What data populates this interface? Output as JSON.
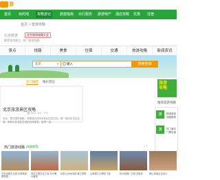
{
  "header": {
    "logo_text": "游"
  },
  "nav": [
    {
      "label": "首页",
      "active": false
    },
    {
      "label": "目的地",
      "active": false
    },
    {
      "label": "攻略游记",
      "active": true
    },
    {
      "label": "旅游指南",
      "active": false
    },
    {
      "label": "出行服务",
      "active": false
    },
    {
      "label": "旅游特产",
      "active": false
    },
    {
      "label": "酒店攻略",
      "active": false
    },
    {
      "label": "优惠",
      "active": false
    },
    {
      "label": "住宿",
      "active": false
    }
  ],
  "breadcrumb": "首页 > 旅游攻略",
  "subhead": {
    "location": "北京旅游",
    "badge": "北京旅游攻略大全",
    "line": "推荐旅游景点 · 热门旅游线路"
  },
  "categories": [
    "景点",
    "线路",
    "美食",
    "住宿",
    "交通",
    "旅游攻略",
    "新闻资讯"
  ],
  "search": {
    "city": "北京",
    "city_arrow": "▼",
    "query": "输入",
    "button": "搜索查询"
  },
  "promo": {
    "line1": "旅游",
    "line2": "攻略"
  },
  "hot_tabs": [
    "热门推荐",
    "精彩游记"
  ],
  "article": {
    "title": "北京旅游景区攻略",
    "meta": "👁 2021  ·  ♥ 4  ·  ✎ 5",
    "desc": "北京，是中国的首都，有着悠久的历史和灿烂的文化，是一座历史文化名城，拥有众多名胜古迹和自然景观，值得一游。"
  },
  "sidebar": {
    "title": "推荐旅游线路",
    "ads": [
      {
        "badge": "游",
        "text": "精选旅游线路推荐"
      },
      {
        "badge": "游",
        "text": "热门景点门票优惠"
      }
    ]
  },
  "lines": {
    "title": "热门旅游线路",
    "tag": "[线路推荐]",
    "pager": "‹ ›",
    "cards": [
      {
        "caption": "北京经典五日游 长城故宫颐和园"
      },
      {
        "caption": "西安古城文化之旅 兵马俑大雁塔"
      },
      {
        "caption": "桂林山水休闲游 漓江阳朔"
      },
      {
        "caption": "云南丽江大理双飞游"
      },
      {
        "caption": "杭州西湖一日游 灵隐寺"
      },
      {
        "caption": "黄山风景区自由行"
      }
    ]
  }
}
